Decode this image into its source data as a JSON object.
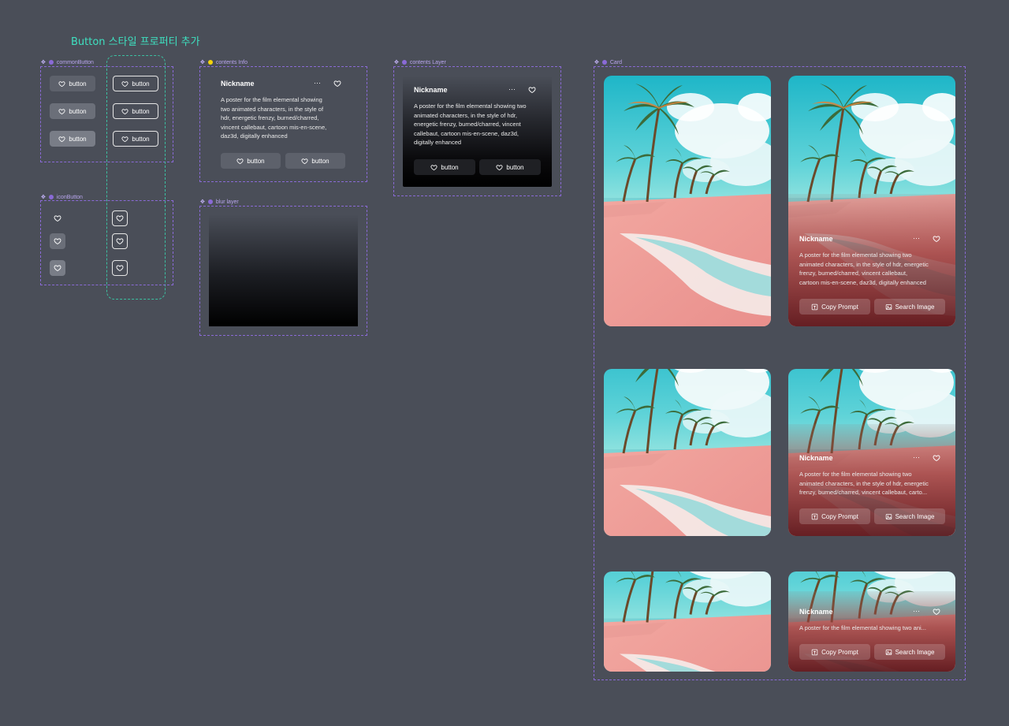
{
  "page_title": "Button 스타일 프로퍼티 추가",
  "sections": {
    "common_button": "commonButton",
    "icon_button": "iconButton",
    "contents_info": "contents Info",
    "blur_layer": "blur layer",
    "contents_layer": "contents Layer",
    "card": "Card"
  },
  "button_label": "button",
  "nickname": "Nickname",
  "more_icon_glyph": "···",
  "description_full": "A poster for the film elemental showing two animated characters, in the style of hdr, energetic frenzy, burned/charred, vincent callebaut, cartoon mis-en-scene, daz3d, digitally enhanced",
  "info_desc_lines": [
    "A poster for the film elemental showing",
    "two animated characters, in the style of",
    "hdr, energetic frenzy, burned/charred,",
    "vincent callebaut, cartoon mis-en-scene,",
    "daz3d, digitally enhanced"
  ],
  "layer_desc_lines": [
    "A poster for the film elemental showing two",
    "animated characters, in the style of hdr,",
    "energetic frenzy, burned/charred, vincent",
    "callebaut, cartoon mis-en-scene, daz3d,",
    "digitally enhanced"
  ],
  "card1_desc_lines": [
    "A poster for the film elemental showing two",
    "animated characters, in the style of hdr, energetic",
    "frenzy, burned/charred, vincent callebaut,",
    "cartoon mis-en-scene, daz3d, digitally enhanced"
  ],
  "card2_desc_lines": [
    "A poster for the film elemental showing two",
    "animated characters, in the style of hdr, energetic",
    "frenzy, burned/charred, vincent callebaut, carto..."
  ],
  "card3_desc_lines": [
    "A poster for the film elemental showing two ani..."
  ],
  "copy_prompt": "Copy Prompt",
  "search_image": "Search Image",
  "colors": {
    "accent_teal": "#3ee0c0",
    "frame_purple": "#8a6ad6",
    "background": "#4a4e58"
  }
}
